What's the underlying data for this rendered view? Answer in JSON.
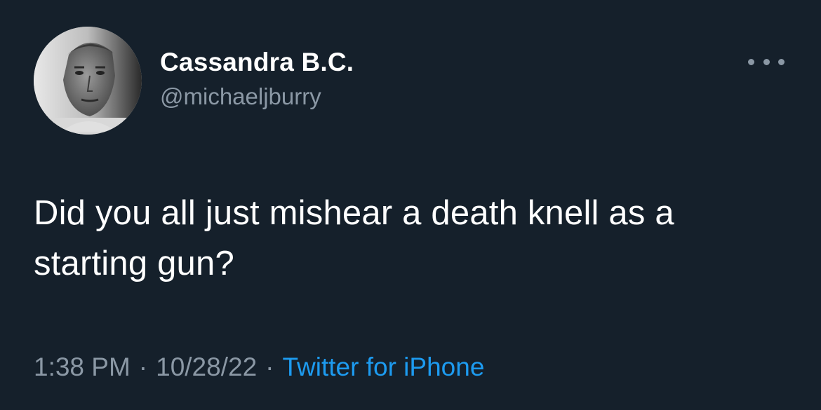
{
  "author": {
    "display_name": "Cassandra B.C.",
    "handle": "@michaeljburry"
  },
  "tweet": {
    "text": "Did you all just mishear a death knell as a starting gun?"
  },
  "meta": {
    "time": "1:38 PM",
    "separator": "·",
    "date": "10/28/22",
    "source": "Twitter for iPhone"
  },
  "colors": {
    "background": "#15202b",
    "primary_text": "#ffffff",
    "secondary_text": "#8b98a5",
    "link": "#1d9bf0"
  },
  "icons": {
    "more": "more-horizontal-icon"
  }
}
